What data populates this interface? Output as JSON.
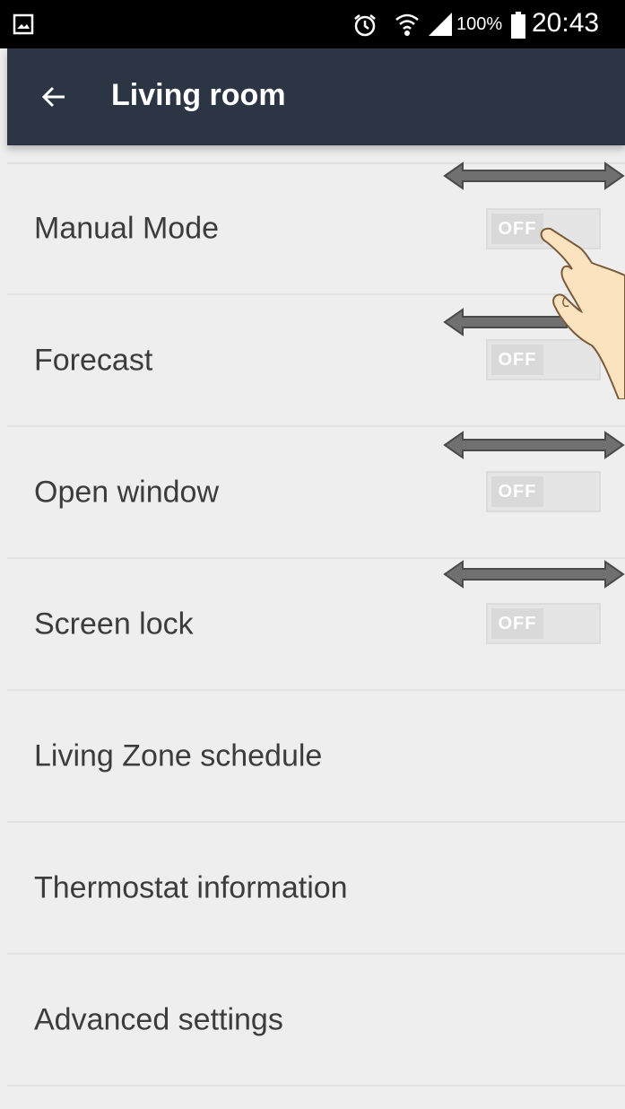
{
  "status_bar": {
    "battery_percent": "100%",
    "time": "20:43",
    "icons": [
      "gallery-icon",
      "alarm-icon",
      "wifi-icon",
      "signal-icon",
      "battery-icon"
    ]
  },
  "app_bar": {
    "back_icon": "arrow-left-icon",
    "title": "Living room",
    "background_color": "#2b3544"
  },
  "settings": [
    {
      "label": "Manual Mode",
      "toggle": "OFF"
    },
    {
      "label": "Forecast",
      "toggle": "OFF"
    },
    {
      "label": "Open window",
      "toggle": "OFF"
    },
    {
      "label": "Screen lock",
      "toggle": "OFF"
    },
    {
      "label": "Living Zone schedule"
    },
    {
      "label": "Thermostat information"
    },
    {
      "label": "Advanced settings"
    }
  ],
  "annotations": {
    "arrow_icon": "double-headed-arrow-icon",
    "hand_icon": "pointing-hand-icon"
  }
}
